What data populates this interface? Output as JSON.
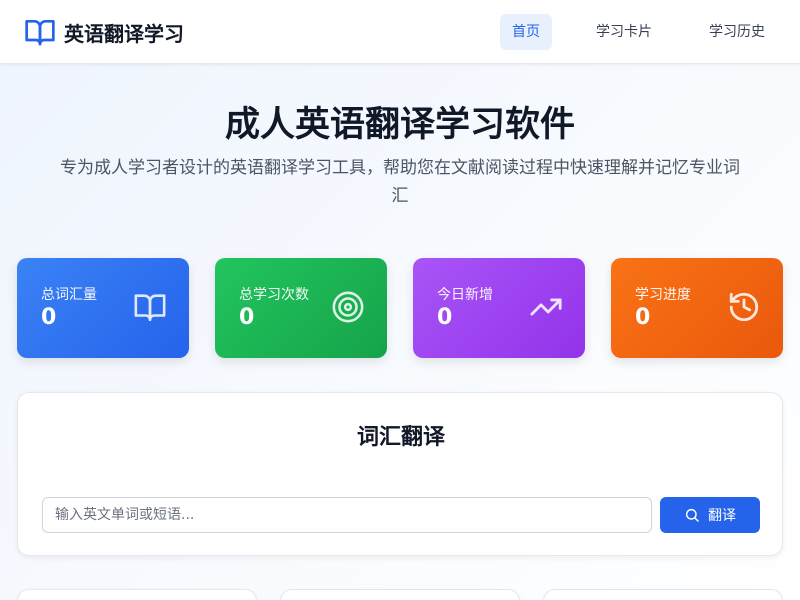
{
  "nav": {
    "brand": "英语翻译学习",
    "brand_icon": "book-open-icon",
    "items": [
      {
        "label": "首页",
        "active": true
      },
      {
        "label": "学习卡片",
        "active": false
      },
      {
        "label": "学习历史",
        "active": false
      }
    ]
  },
  "hero": {
    "title": "成人英语翻译学习软件",
    "subtitle": "专为成人学习者设计的英语翻译学习工具，帮助您在文献阅读过程中快速理解并记忆专业词汇"
  },
  "stats": [
    {
      "label": "总词汇量",
      "value": "0",
      "icon": "book-open-icon",
      "color": "#3b82f6"
    },
    {
      "label": "总学习次数",
      "value": "0",
      "icon": "target-icon",
      "color": "#22c55e"
    },
    {
      "label": "今日新增",
      "value": "0",
      "icon": "trending-up-icon",
      "color": "#a855f7"
    },
    {
      "label": "学习进度",
      "value": "0",
      "icon": "history-icon",
      "color": "#f97316"
    }
  ],
  "translate": {
    "title": "词汇翻译",
    "placeholder": "输入英文单词或短语...",
    "value": "",
    "button_label": "翻译",
    "button_icon": "search-icon"
  },
  "colors": {
    "accent": "#2563eb",
    "nav_active_bg": "#e8f0fe"
  }
}
